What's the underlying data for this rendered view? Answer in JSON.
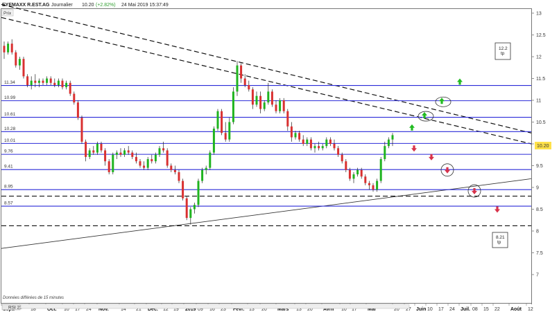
{
  "header": {
    "symbol": "EYEMAXX R.EST.AG",
    "period": "Journalier",
    "price": "10.20",
    "change": "(+2.82%)",
    "datetime": "24 Mai 2019 15:37:49"
  },
  "prix_label": "Prix",
  "footer_note": "Données différées de 15 minutes",
  "rsi_label": "RSI 21",
  "chart_data": {
    "type": "candlestick",
    "y_range": [
      6.65,
      13.3
    ],
    "y_ticks": [
      "13",
      "12.5",
      "12",
      "11.5",
      "11",
      "10.5",
      "10",
      "9.5",
      "9",
      "8.5",
      "8",
      "7.5",
      "7"
    ],
    "x_ticks": [
      "Sept.",
      "18",
      "Oct.",
      "10",
      "17",
      "24",
      "Nov.",
      "14",
      "21",
      "Déc.",
      "12",
      "19",
      "2019",
      "09",
      "16",
      "23",
      "Févr.",
      "13",
      "20",
      "Mars",
      "13",
      "20",
      "Avril",
      "10",
      "17",
      "Mai",
      "20",
      "27",
      "Juin",
      "10",
      "17",
      "24",
      "Juil.",
      "08",
      "15",
      "22",
      "Août",
      "12"
    ],
    "last_price": "10.20",
    "horizontal_levels": [
      11.34,
      10.99,
      10.61,
      10.28,
      10.01,
      9.76,
      9.41,
      8.95,
      8.57
    ],
    "horizontal_level_labels": [
      "11.34",
      "10.99",
      "10.61",
      "10.28",
      "10.01",
      "9.76",
      "9.41",
      "8.95",
      "8.57"
    ],
    "dashed_levels": [
      8.8,
      8.12
    ],
    "target_boxes": [
      {
        "value": "12.2",
        "label": "tp"
      },
      {
        "value": "8.21",
        "label": "tp"
      }
    ],
    "trendlines": [
      {
        "style": "dashed",
        "from": [
          "Sept.",
          12.9
        ],
        "to": [
          "Août",
          10.0
        ]
      },
      {
        "style": "dashed",
        "from": [
          "Sept.",
          13.2
        ],
        "to": [
          "Août",
          10.25
        ]
      },
      {
        "style": "solid",
        "from": [
          "Sept.",
          7.6
        ],
        "to": [
          "Août",
          9.2
        ]
      }
    ],
    "signals_up": [
      10.37,
      10.65,
      10.98,
      11.42
    ],
    "signals_down": [
      9.9,
      9.7,
      9.4,
      8.92,
      8.5
    ],
    "colors": {
      "up": "#1fb41f",
      "down": "#d93030",
      "level": "#2a2ad8",
      "signal_up": "#22bb22",
      "signal_down": "#d8324a"
    },
    "ohlc": [
      [
        12.25,
        12.35,
        11.95,
        12.1
      ],
      [
        12.1,
        12.35,
        12.05,
        12.3
      ],
      [
        12.3,
        12.4,
        12.05,
        12.1
      ],
      [
        12.1,
        12.15,
        11.75,
        11.8
      ],
      [
        11.8,
        12.0,
        11.7,
        11.95
      ],
      [
        11.95,
        12.0,
        11.5,
        11.55
      ],
      [
        11.55,
        11.6,
        11.3,
        11.35
      ],
      [
        11.35,
        11.55,
        11.25,
        11.45
      ],
      [
        11.45,
        11.6,
        11.3,
        11.4
      ],
      [
        11.4,
        11.5,
        11.3,
        11.45
      ],
      [
        11.45,
        11.5,
        11.35,
        11.4
      ],
      [
        11.4,
        11.55,
        11.35,
        11.5
      ],
      [
        11.5,
        11.55,
        11.35,
        11.4
      ],
      [
        11.4,
        11.5,
        11.3,
        11.35
      ],
      [
        11.35,
        11.5,
        11.3,
        11.45
      ],
      [
        11.45,
        11.5,
        11.25,
        11.3
      ],
      [
        11.3,
        11.45,
        11.25,
        11.4
      ],
      [
        11.4,
        11.45,
        11.1,
        11.15
      ],
      [
        11.15,
        11.2,
        10.9,
        10.95
      ],
      [
        10.95,
        11.0,
        10.55,
        10.6
      ],
      [
        10.6,
        10.65,
        10.0,
        10.05
      ],
      [
        10.05,
        10.1,
        9.6,
        9.7
      ],
      [
        9.7,
        9.9,
        9.65,
        9.85
      ],
      [
        9.85,
        9.95,
        9.75,
        9.8
      ],
      [
        9.8,
        10.05,
        9.75,
        10.0
      ],
      [
        10.0,
        10.05,
        9.8,
        9.85
      ],
      [
        9.85,
        9.9,
        9.5,
        9.6
      ],
      [
        9.6,
        9.65,
        9.3,
        9.35
      ],
      [
        9.35,
        9.8,
        9.3,
        9.75
      ],
      [
        9.75,
        9.85,
        9.65,
        9.8
      ],
      [
        9.8,
        9.9,
        9.7,
        9.75
      ],
      [
        9.75,
        9.9,
        9.7,
        9.85
      ],
      [
        9.85,
        9.95,
        9.75,
        9.8
      ],
      [
        9.8,
        9.85,
        9.65,
        9.7
      ],
      [
        9.7,
        9.8,
        9.55,
        9.6
      ],
      [
        9.6,
        9.65,
        9.45,
        9.5
      ],
      [
        9.5,
        9.6,
        9.4,
        9.45
      ],
      [
        9.45,
        9.7,
        9.4,
        9.65
      ],
      [
        9.65,
        9.75,
        9.55,
        9.6
      ],
      [
        9.6,
        9.8,
        9.55,
        9.75
      ],
      [
        9.75,
        9.95,
        9.7,
        9.9
      ],
      [
        9.9,
        10.05,
        9.8,
        9.85
      ],
      [
        9.85,
        9.9,
        9.45,
        9.5
      ],
      [
        9.5,
        9.55,
        9.35,
        9.4
      ],
      [
        9.4,
        9.5,
        9.3,
        9.35
      ],
      [
        9.35,
        9.4,
        9.1,
        9.15
      ],
      [
        9.15,
        9.2,
        8.7,
        8.75
      ],
      [
        8.75,
        8.8,
        8.25,
        8.3
      ],
      [
        8.3,
        8.55,
        8.15,
        8.5
      ],
      [
        8.5,
        8.65,
        8.4,
        8.6
      ],
      [
        8.6,
        9.2,
        8.55,
        9.15
      ],
      [
        9.15,
        9.45,
        9.1,
        9.4
      ],
      [
        9.4,
        9.5,
        9.3,
        9.45
      ],
      [
        9.45,
        9.85,
        9.4,
        9.8
      ],
      [
        9.8,
        10.4,
        9.75,
        10.35
      ],
      [
        10.35,
        10.8,
        10.3,
        10.75
      ],
      [
        10.75,
        10.8,
        10.2,
        10.25
      ],
      [
        10.25,
        10.5,
        10.05,
        10.1
      ],
      [
        10.1,
        10.6,
        10.05,
        10.5
      ],
      [
        10.5,
        11.3,
        10.45,
        11.2
      ],
      [
        11.2,
        11.9,
        11.1,
        11.8
      ],
      [
        11.8,
        11.85,
        11.4,
        11.5
      ],
      [
        11.5,
        11.6,
        11.3,
        11.35
      ],
      [
        11.35,
        11.45,
        11.2,
        11.25
      ],
      [
        11.25,
        11.3,
        10.8,
        10.9
      ],
      [
        10.9,
        11.2,
        10.85,
        11.1
      ],
      [
        11.1,
        11.2,
        10.7,
        10.8
      ],
      [
        10.8,
        11.0,
        10.75,
        10.95
      ],
      [
        10.95,
        11.4,
        10.9,
        11.2
      ],
      [
        11.2,
        11.25,
        10.85,
        10.9
      ],
      [
        10.9,
        11.0,
        10.7,
        10.75
      ],
      [
        10.75,
        11.05,
        10.7,
        11.0
      ],
      [
        11.0,
        11.05,
        10.7,
        10.75
      ],
      [
        10.75,
        10.8,
        10.3,
        10.4
      ],
      [
        10.4,
        10.5,
        10.05,
        10.15
      ],
      [
        10.15,
        10.3,
        10.1,
        10.25
      ],
      [
        10.25,
        10.3,
        10.05,
        10.1
      ],
      [
        10.1,
        10.2,
        9.95,
        10.0
      ],
      [
        10.0,
        10.15,
        9.95,
        10.1
      ],
      [
        10.1,
        10.15,
        9.85,
        9.9
      ],
      [
        9.9,
        10.0,
        9.8,
        9.95
      ],
      [
        9.95,
        10.05,
        9.85,
        9.9
      ],
      [
        9.9,
        10.0,
        9.85,
        9.95
      ],
      [
        9.95,
        10.15,
        9.9,
        10.1
      ],
      [
        10.1,
        10.15,
        9.95,
        10.0
      ],
      [
        10.0,
        10.1,
        9.85,
        9.9
      ],
      [
        9.9,
        9.95,
        9.7,
        9.75
      ],
      [
        9.75,
        9.8,
        9.55,
        9.6
      ],
      [
        9.6,
        9.65,
        9.35,
        9.4
      ],
      [
        9.4,
        9.45,
        9.15,
        9.2
      ],
      [
        9.2,
        9.35,
        9.1,
        9.3
      ],
      [
        9.3,
        9.45,
        9.25,
        9.4
      ],
      [
        9.4,
        9.45,
        9.2,
        9.25
      ],
      [
        9.25,
        9.3,
        9.05,
        9.1
      ],
      [
        9.1,
        9.15,
        8.95,
        9.05
      ],
      [
        9.05,
        9.1,
        8.9,
        8.95
      ],
      [
        8.95,
        9.2,
        8.9,
        9.15
      ],
      [
        9.15,
        9.7,
        9.1,
        9.65
      ],
      [
        9.65,
        10.05,
        9.6,
        9.95
      ],
      [
        9.95,
        10.15,
        9.9,
        10.1
      ],
      [
        10.1,
        10.25,
        9.95,
        10.2
      ]
    ]
  }
}
